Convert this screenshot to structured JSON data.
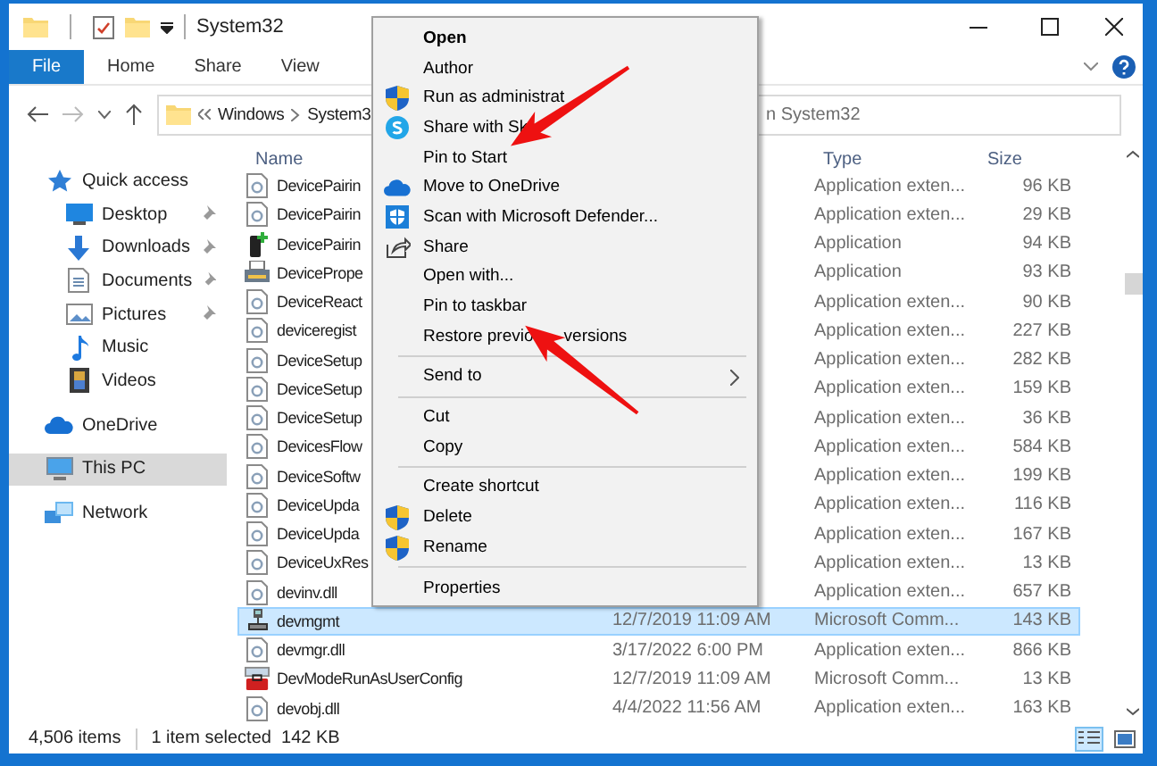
{
  "window": {
    "title": "System32",
    "controls": [
      {
        "kind": "minimize"
      },
      {
        "kind": "maximize"
      },
      {
        "kind": "close"
      }
    ]
  },
  "ribbon": {
    "tabs": [
      {
        "label": "File",
        "kind": "file"
      },
      {
        "label": "Home",
        "kind": "tab"
      },
      {
        "label": "Share",
        "kind": "tab"
      },
      {
        "label": "View",
        "kind": "tab"
      }
    ]
  },
  "address": {
    "path": [
      "Windows",
      "System3"
    ]
  },
  "search": {
    "placeholder": "n System32"
  },
  "navigation": [
    {
      "label": "Quick access",
      "selected": false,
      "children": [
        {
          "label": "Desktop",
          "pinned": true,
          "selected": false
        },
        {
          "label": "Downloads",
          "pinned": true,
          "selected": false
        },
        {
          "label": "Documents",
          "pinned": true,
          "selected": false
        },
        {
          "label": "Pictures",
          "pinned": true,
          "selected": false
        },
        {
          "label": "Music",
          "pinned": false,
          "selected": false
        },
        {
          "label": "Videos",
          "pinned": false,
          "selected": false
        }
      ]
    },
    {
      "label": "OneDrive",
      "selected": false
    },
    {
      "label": "This PC",
      "selected": true
    },
    {
      "label": "Network",
      "selected": false
    }
  ],
  "table": {
    "columns": {
      "name": "Name",
      "type": "Type",
      "size": "Size"
    },
    "rows": [
      {
        "kind": "dll",
        "name": "DevicePairin",
        "type": "Application exten...",
        "size": "96 KB",
        "selected": false
      },
      {
        "kind": "dll",
        "name": "DevicePairin",
        "type": "Application exten...",
        "size": "29 KB",
        "selected": false
      },
      {
        "kind": "phone",
        "name": "DevicePairin",
        "type": "Application",
        "size": "94 KB",
        "selected": false
      },
      {
        "kind": "printer",
        "name": "DevicePrope",
        "type": "Application",
        "size": "93 KB",
        "selected": false
      },
      {
        "kind": "dll",
        "name": "DeviceReact",
        "type": "Application exten...",
        "size": "90 KB",
        "selected": false
      },
      {
        "kind": "dll",
        "name": "deviceregist",
        "type": "Application exten...",
        "size": "227 KB",
        "selected": false
      },
      {
        "kind": "dll",
        "name": "DeviceSetup",
        "type": "Application exten...",
        "size": "282 KB",
        "selected": false
      },
      {
        "kind": "dll",
        "name": "DeviceSetup",
        "type": "Application exten...",
        "size": "159 KB",
        "selected": false
      },
      {
        "kind": "dll",
        "name": "DeviceSetup",
        "type": "Application exten...",
        "size": "36 KB",
        "selected": false
      },
      {
        "kind": "dll",
        "name": "DevicesFlow",
        "type": "Application exten...",
        "size": "584 KB",
        "selected": false
      },
      {
        "kind": "dll",
        "name": "DeviceSoftw",
        "type": "Application exten...",
        "size": "199 KB",
        "selected": false
      },
      {
        "kind": "dll",
        "name": "DeviceUpda",
        "type": "Application exten...",
        "size": "116 KB",
        "selected": false
      },
      {
        "kind": "dll",
        "name": "DeviceUpda",
        "type": "Application exten...",
        "size": "167 KB",
        "selected": false
      },
      {
        "kind": "dll",
        "name": "DeviceUxRes",
        "type": "Application exten...",
        "size": "13 KB",
        "selected": false
      },
      {
        "kind": "dll",
        "name": "devinv.dll",
        "type": "Application exten...",
        "size": "657 KB",
        "selected": false
      },
      {
        "kind": "console",
        "name": "devmgmt",
        "date": "12/7/2019 11:09 AM",
        "type": "Microsoft Comm...",
        "size": "143 KB",
        "selected": true
      },
      {
        "kind": "dll",
        "name": "devmgr.dll",
        "date": "3/17/2022 6:00 PM",
        "type": "Application exten...",
        "size": "866 KB",
        "selected": false
      },
      {
        "kind": "toolbox",
        "name": "DevModeRunAsUserConfig",
        "date": "12/7/2019 11:09 AM",
        "type": "Microsoft Comm...",
        "size": "13 KB",
        "selected": false
      },
      {
        "kind": "dll",
        "name": "devobj.dll",
        "date": "4/4/2022 11:56 AM",
        "type": "Application exten...",
        "size": "163 KB",
        "selected": false
      }
    ]
  },
  "status_bar": {
    "items": "4,506 items",
    "selection": "1 item selected  142 KB"
  },
  "context_menu": {
    "items": [
      {
        "kind": "item",
        "label": "Open",
        "default": true
      },
      {
        "kind": "item",
        "label": "Author"
      },
      {
        "kind": "item",
        "label": "Run as administrat"
      },
      {
        "kind": "item",
        "label": "Share with Sk"
      },
      {
        "kind": "item",
        "label": "Pin to Start"
      },
      {
        "kind": "item",
        "label": "Move to OneDrive"
      },
      {
        "kind": "item",
        "label": "Scan with Microsoft Defender..."
      },
      {
        "kind": "item",
        "label": "Share"
      },
      {
        "kind": "item",
        "label": "Open with..."
      },
      {
        "kind": "item",
        "label": "Pin to taskbar"
      },
      {
        "kind": "item",
        "label": "Restore previo",
        "label_continued": "versions"
      },
      {
        "kind": "separator"
      },
      {
        "kind": "item",
        "label": "Send to",
        "submenu": true
      },
      {
        "kind": "separator"
      },
      {
        "kind": "item",
        "label": "Cut"
      },
      {
        "kind": "item",
        "label": "Copy"
      },
      {
        "kind": "separator"
      },
      {
        "kind": "item",
        "label": "Create shortcut"
      },
      {
        "kind": "item",
        "label": "Delete"
      },
      {
        "kind": "item",
        "label": "Rename"
      },
      {
        "kind": "separator"
      },
      {
        "kind": "item",
        "label": "Properties"
      }
    ]
  },
  "annotations": [
    {
      "kind": "arrow"
    },
    {
      "kind": "arrow"
    }
  ]
}
